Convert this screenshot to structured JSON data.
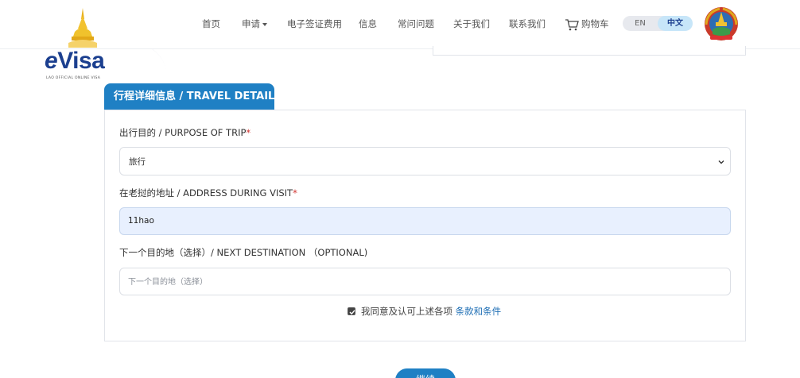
{
  "logo": {
    "brand_e": "e",
    "brand_rest": "Visa",
    "subtitle": "LAO OFFICIAL ONLINE VISA"
  },
  "nav": {
    "items": [
      {
        "label": "首页"
      },
      {
        "label": "申请"
      },
      {
        "label": "电子签证费用"
      },
      {
        "label": "信息"
      },
      {
        "label": "常问问题"
      },
      {
        "label": "关于我们"
      },
      {
        "label": "联系我们"
      },
      {
        "label": "购物车"
      }
    ],
    "language": {
      "en": "EN",
      "zh": "中文",
      "selected": "中文"
    }
  },
  "section": {
    "title": "行程详细信息 / TRAVEL DETAILS"
  },
  "form": {
    "purpose": {
      "label": "出行目的 / PURPOSE OF TRIP",
      "required_mark": "*",
      "value": "旅行"
    },
    "address": {
      "label": "在老挝的地址 / ADDRESS DURING VISIT",
      "required_mark": "*",
      "value": "11hao"
    },
    "next_destination": {
      "label": "下一个目的地（选择）/ NEXT DESTINATION （OPTIONAL)",
      "placeholder": "下一个目的地（选择）"
    },
    "agreement": {
      "text": "我同意及认可上述各项 ",
      "link": "条款和条件",
      "checked": true
    }
  },
  "next_button": {
    "label": "继续"
  },
  "colors": {
    "primary": "#1f80c4",
    "brand_blue": "#1b3f8f",
    "required": "#d0312d",
    "autofill_bg": "#e8f0fe"
  }
}
